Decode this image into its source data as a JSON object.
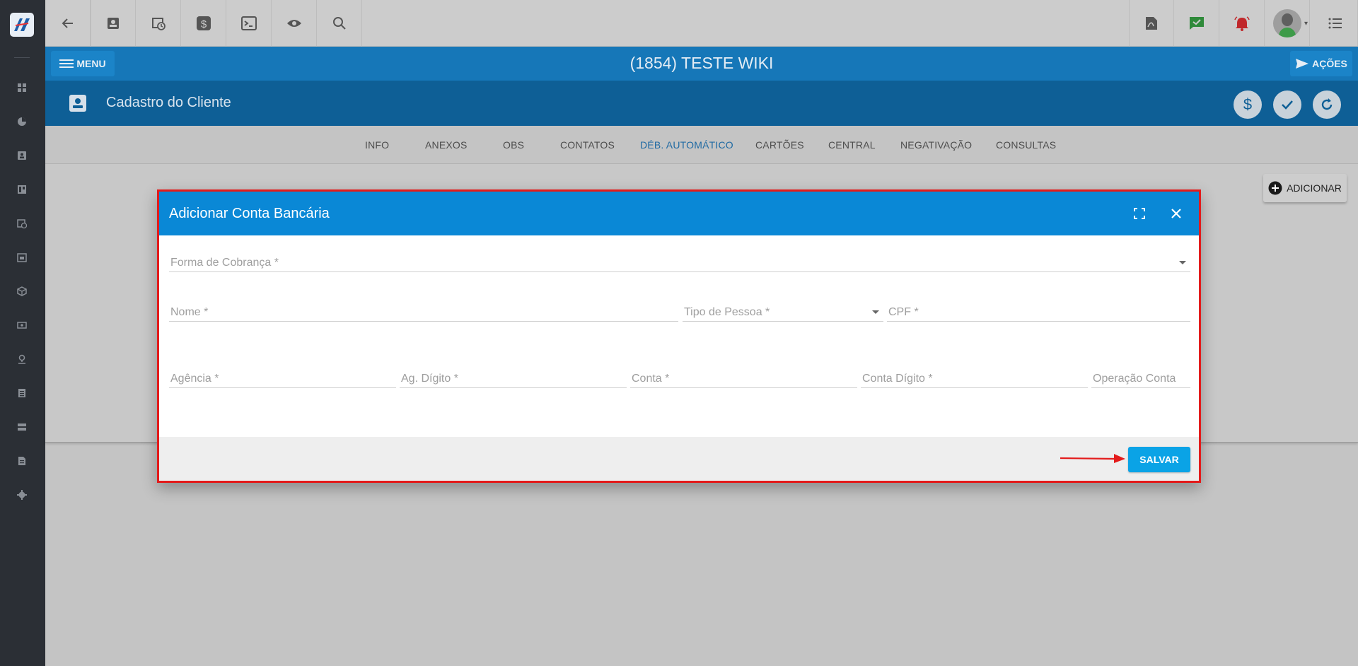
{
  "sidebar": {
    "icons": [
      "dashboard-icon",
      "pie-chart-icon",
      "contact-card-icon",
      "board-icon",
      "calendar-clock-icon",
      "calendar-icon",
      "package-icon",
      "cash-icon",
      "location-icon",
      "list-icon",
      "server-icon",
      "document-icon",
      "gear-icon"
    ]
  },
  "topbar": {
    "left_icons": [
      "back-arrow-icon",
      "contact-card-icon",
      "calendar-clock-icon",
      "dollar-icon",
      "terminal-icon",
      "eye-icon",
      "search-icon"
    ],
    "right_icons": [
      "pdf-icon",
      "chat-check-icon",
      "alarm-bell-icon",
      "avatar",
      "list-menu-icon"
    ]
  },
  "header": {
    "menu_label": "MENU",
    "title": "(1854) TESTE WIKI",
    "acoes_label": "AÇÕES"
  },
  "subheader": {
    "title": "Cadastro do Cliente"
  },
  "tabs": [
    "INFO",
    "ANEXOS",
    "OBS",
    "CONTATOS",
    "DÉB. AUTOMÁTICO",
    "CARTÕES",
    "CENTRAL",
    "NEGATIVAÇÃO",
    "CONSULTAS"
  ],
  "active_tab": "DÉB. AUTOMÁTICO",
  "content": {
    "add_label": "ADICIONAR"
  },
  "modal": {
    "title": "Adicionar Conta Bancária",
    "fields": {
      "forma_cobranca": "Forma de Cobrança *",
      "nome": "Nome *",
      "tipo_pessoa": "Tipo de Pessoa *",
      "cpf": "CPF *",
      "agencia": "Agência *",
      "ag_digito": "Ag. Dígito *",
      "conta": "Conta *",
      "conta_digito": "Conta Dígito *",
      "operacao_conta": "Operação Conta"
    },
    "save_label": "SALVAR"
  },
  "colors": {
    "primary": "#1677b8",
    "primary_dark": "#0e5f96",
    "modal_header": "#0a88d6",
    "save_button": "#0aa3e6",
    "highlight": "#e31b1b"
  }
}
